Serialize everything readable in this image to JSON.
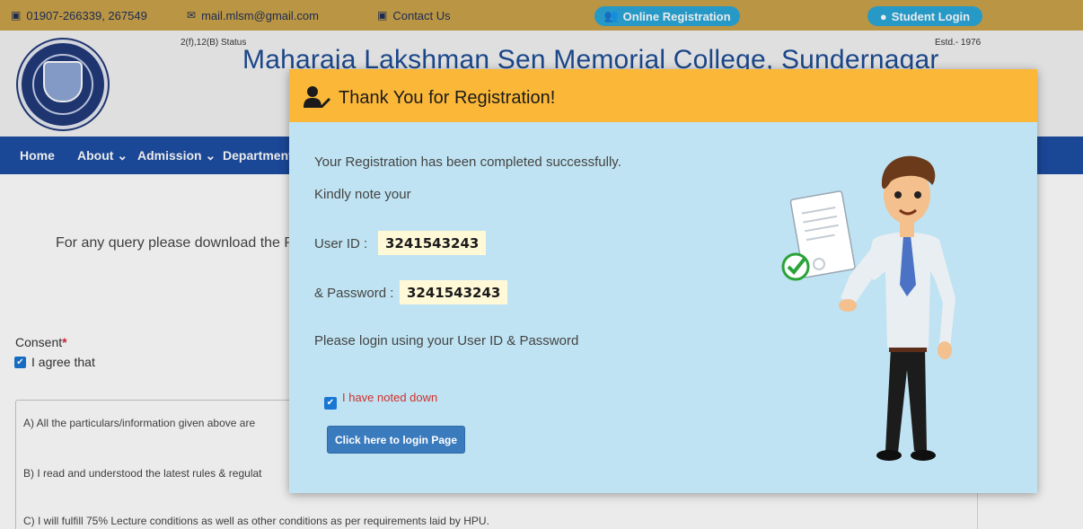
{
  "topbar": {
    "phone": "01907-266339, 267549",
    "email": "mail.mlsm@gmail.com",
    "contact": "Contact Us",
    "online_registration": "Online Registration",
    "student_login": "Student Login"
  },
  "header": {
    "status": "2(f),12(B) Status",
    "estd": "Estd.- 1976",
    "college_name": "Maharaja Lakshman Sen Memorial College, Sundernagar"
  },
  "nav": {
    "items": [
      "Home",
      "About ⌄",
      "Admission ⌄",
      "Department"
    ]
  },
  "page": {
    "query_text": "For any query please download the Pr",
    "consent_label": "Consent",
    "consent_required": "*",
    "agree_label": "I agree that",
    "terms": [
      "A) All the particulars/information given above are",
      "B) I read and understood the latest rules & regulat",
      "C) I will fulfill 75% Lecture conditions as well as other conditions as per requirements laid by HPU."
    ]
  },
  "modal": {
    "title": "Thank You for Registration!",
    "success_text": "Your Registration has been completed successfully.",
    "note_text": "Kindly note your",
    "user_id_label": "User ID :",
    "user_id_value": "3241543243",
    "password_label": "& Password :",
    "password_value": "3241543243",
    "login_instruction": "Please login using your User ID & Password",
    "noted_label": "I have noted down",
    "noted_checked": true,
    "login_button": "Click here to login Page"
  },
  "colors": {
    "topbar": "#c9a24a",
    "nav": "#1d4ea3",
    "modal_header": "#fbb838",
    "modal_body": "#bfe3f2",
    "pill": "#2aa6d8"
  }
}
